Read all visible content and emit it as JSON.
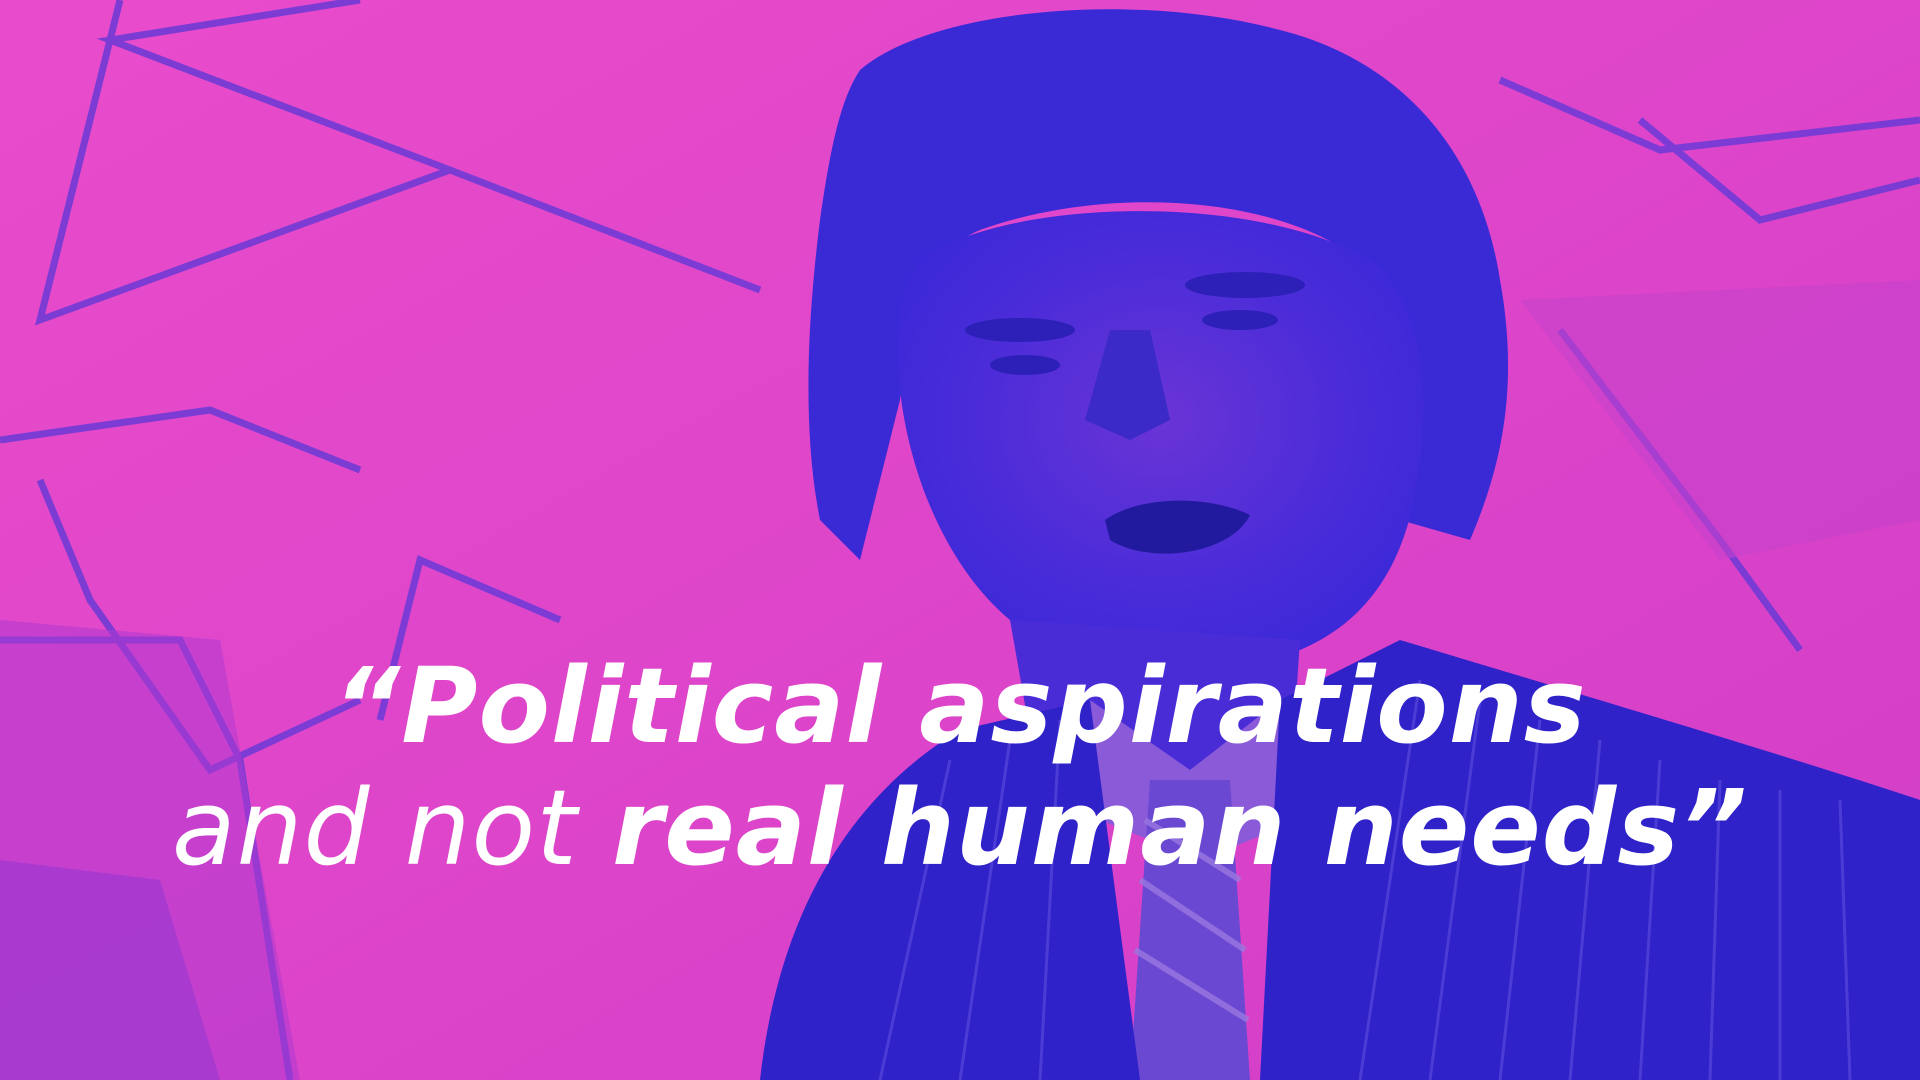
{
  "colors": {
    "magenta": "#e844c8",
    "blue": "#3d2bd8",
    "text": "#ffffff"
  },
  "quote": {
    "line1": "“Political aspirations",
    "line2_light": "and not ",
    "line2_bold": "real human needs”"
  }
}
